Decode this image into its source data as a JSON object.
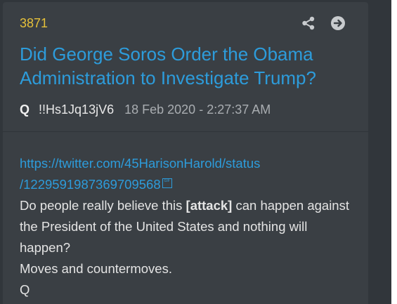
{
  "post": {
    "number": "3871",
    "title": "Did George Soros Order the Obama Administration to Investigate Trump?",
    "author": "Q",
    "tripcode": "!!Hs1Jq13jV6",
    "timestamp": "18 Feb 2020 - 2:27:37 AM",
    "link_line1": "https://twitter.com/45HarisonHarold/status",
    "link_line2": "/1229591987369709568",
    "link_glyph": "GIF",
    "text_before_bold": "Do people really believe this ",
    "text_bold": "[attack]",
    "text_after_bold": " can happen against the President of the United States and nothing will happen?",
    "line_moves": "Moves and countermoves.",
    "signature": "Q"
  },
  "actions": {
    "share_icon": "share-icon",
    "go_icon": "arrow-right-circle-icon"
  },
  "colors": {
    "accent": "#2d9cdb",
    "post_number": "#e6c13a",
    "background": "#31363b",
    "card": "#3a3f44"
  }
}
